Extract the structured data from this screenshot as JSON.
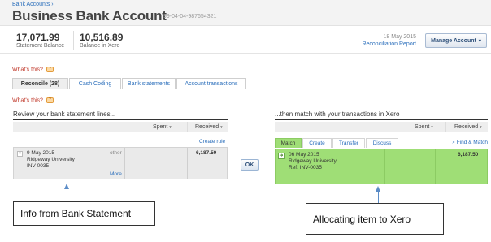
{
  "header": {
    "breadcrumb": "Bank Accounts ›",
    "title": "Business Bank Account",
    "account_number": "99-04-04-987654321"
  },
  "summary": {
    "statement_balance_value": "17,071.99",
    "statement_balance_label": "Statement Balance",
    "xero_balance_value": "10,516.89",
    "xero_balance_label": "Balance in Xero",
    "date": "18 May 2015",
    "reconciliation_report": "Reconciliation Report",
    "manage_account": "Manage Account",
    "manage_account_arrow": "▾"
  },
  "whats_this": "What's this?",
  "tabs": [
    {
      "label": "Reconcile (28)",
      "active": true
    },
    {
      "label": "Cash Coding",
      "active": false
    },
    {
      "label": "Bank statements",
      "active": false
    },
    {
      "label": "Account transactions",
      "active": false
    }
  ],
  "left": {
    "heading": "Review your bank statement lines...",
    "col_spent": "Spent",
    "col_received": "Received",
    "sort_arrow": "▾",
    "create_rule": "Create rule",
    "line": {
      "date": "9 May 2015",
      "payee": "Ridgeway University",
      "reference": "INV-0035",
      "type": "other",
      "more": "More",
      "received": "6,187.50"
    }
  },
  "ok_button": "OK",
  "right": {
    "heading": "...then match with your transactions in Xero",
    "col_spent": "Spent",
    "col_received": "Received",
    "sort_arrow": "▾",
    "subtabs": [
      "Match",
      "Create",
      "Transfer",
      "Discuss"
    ],
    "find_match": "Find & Match",
    "line": {
      "date": "06 May 2015",
      "payee": "Ridgeway University",
      "reference": "Ref: INV-0035",
      "received": "6,187.50"
    }
  },
  "annotations": {
    "left_callout": "Info from Bank Statement",
    "right_callout": "Allocating item to Xero"
  },
  "colors": {
    "accent_link": "#2a6ebb",
    "match_green": "#9fde76",
    "callout_arrow": "#5b8cc7"
  }
}
